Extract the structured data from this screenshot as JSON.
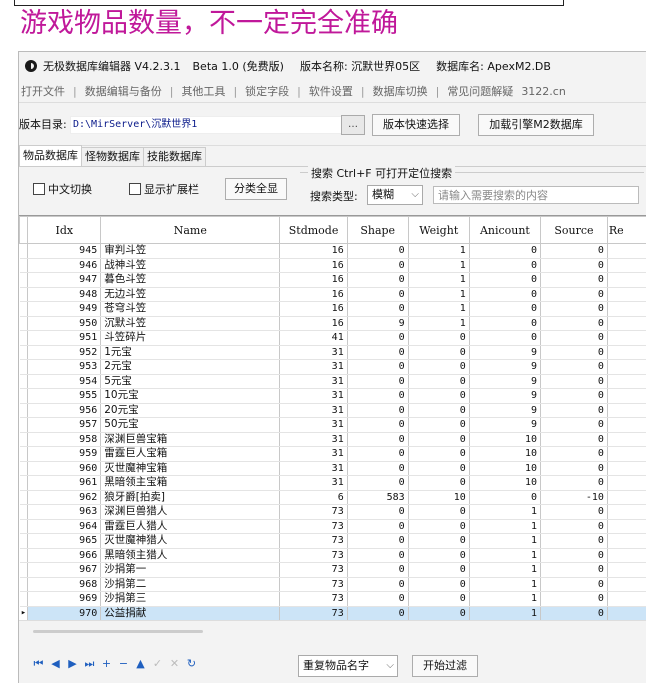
{
  "headline": "游戏物品数量，不一定完全准确",
  "window": {
    "app_title": "无极数据库编辑器 V4.2.3.1",
    "edition": "Beta 1.0 (免费版)",
    "version_name": "版本名称: 沉默世界05区",
    "db_name": "数据库名: ApexM2.DB"
  },
  "menu": [
    "打开文件",
    "数据编辑与备份",
    "其他工具",
    "锁定字段",
    "软件设置",
    "数据库切换",
    "常见问题解疑"
  ],
  "menu_extra": "3122.cn",
  "toolbar": {
    "dir_label": "版本目录:",
    "dir_path": "D:\\MirServer\\沉默世界1",
    "folder_icon_text": "…",
    "quick_select": "版本快速选择",
    "load_engine": "加载引擎M2数据库"
  },
  "tabs": [
    "物品数据库",
    "怪物数据库",
    "技能数据库"
  ],
  "filters": {
    "chinese_toggle": "中文切换",
    "show_ext": "显示扩展栏",
    "classify_btn": "分类全显",
    "search_legend": "搜索  Ctrl+F 可打开定位搜索",
    "search_type_label": "搜索类型:",
    "search_type_value": "模糊",
    "search_placeholder": "请输入需要搜索的内容"
  },
  "table": {
    "columns": [
      "Idx",
      "Name",
      "Stdmode",
      "Shape",
      "Weight",
      "Anicount",
      "Source",
      "Re"
    ],
    "rows": [
      {
        "idx": "945",
        "name": "审判斗笠",
        "stdmode": "16",
        "shape": "0",
        "weight": "1",
        "anicount": "0",
        "source": "0"
      },
      {
        "idx": "946",
        "name": "战神斗笠",
        "stdmode": "16",
        "shape": "0",
        "weight": "1",
        "anicount": "0",
        "source": "0"
      },
      {
        "idx": "947",
        "name": "暮色斗笠",
        "stdmode": "16",
        "shape": "0",
        "weight": "1",
        "anicount": "0",
        "source": "0"
      },
      {
        "idx": "948",
        "name": "无边斗笠",
        "stdmode": "16",
        "shape": "0",
        "weight": "1",
        "anicount": "0",
        "source": "0"
      },
      {
        "idx": "949",
        "name": "苍穹斗笠",
        "stdmode": "16",
        "shape": "0",
        "weight": "1",
        "anicount": "0",
        "source": "0"
      },
      {
        "idx": "950",
        "name": "沉默斗笠",
        "stdmode": "16",
        "shape": "9",
        "weight": "1",
        "anicount": "0",
        "source": "0"
      },
      {
        "idx": "951",
        "name": "斗笠碎片",
        "stdmode": "41",
        "shape": "0",
        "weight": "0",
        "anicount": "0",
        "source": "0"
      },
      {
        "idx": "952",
        "name": "1元宝",
        "stdmode": "31",
        "shape": "0",
        "weight": "0",
        "anicount": "9",
        "source": "0"
      },
      {
        "idx": "953",
        "name": "2元宝",
        "stdmode": "31",
        "shape": "0",
        "weight": "0",
        "anicount": "9",
        "source": "0"
      },
      {
        "idx": "954",
        "name": "5元宝",
        "stdmode": "31",
        "shape": "0",
        "weight": "0",
        "anicount": "9",
        "source": "0"
      },
      {
        "idx": "955",
        "name": "10元宝",
        "stdmode": "31",
        "shape": "0",
        "weight": "0",
        "anicount": "9",
        "source": "0"
      },
      {
        "idx": "956",
        "name": "20元宝",
        "stdmode": "31",
        "shape": "0",
        "weight": "0",
        "anicount": "9",
        "source": "0"
      },
      {
        "idx": "957",
        "name": "50元宝",
        "stdmode": "31",
        "shape": "0",
        "weight": "0",
        "anicount": "9",
        "source": "0"
      },
      {
        "idx": "958",
        "name": "深渊巨兽宝箱",
        "stdmode": "31",
        "shape": "0",
        "weight": "0",
        "anicount": "10",
        "source": "0"
      },
      {
        "idx": "959",
        "name": "雷霆巨人宝箱",
        "stdmode": "31",
        "shape": "0",
        "weight": "0",
        "anicount": "10",
        "source": "0"
      },
      {
        "idx": "960",
        "name": "灭世魔神宝箱",
        "stdmode": "31",
        "shape": "0",
        "weight": "0",
        "anicount": "10",
        "source": "0"
      },
      {
        "idx": "961",
        "name": "黑暗领主宝箱",
        "stdmode": "31",
        "shape": "0",
        "weight": "0",
        "anicount": "10",
        "source": "0"
      },
      {
        "idx": "962",
        "name": "狼牙爵[拍卖]",
        "stdmode": "6",
        "shape": "583",
        "weight": "10",
        "anicount": "0",
        "source": "-10"
      },
      {
        "idx": "963",
        "name": "深渊巨兽猎人",
        "stdmode": "73",
        "shape": "0",
        "weight": "0",
        "anicount": "1",
        "source": "0"
      },
      {
        "idx": "964",
        "name": "雷霆巨人猎人",
        "stdmode": "73",
        "shape": "0",
        "weight": "0",
        "anicount": "1",
        "source": "0"
      },
      {
        "idx": "965",
        "name": "灭世魔神猎人",
        "stdmode": "73",
        "shape": "0",
        "weight": "0",
        "anicount": "1",
        "source": "0"
      },
      {
        "idx": "966",
        "name": "黑暗领主猎人",
        "stdmode": "73",
        "shape": "0",
        "weight": "0",
        "anicount": "1",
        "source": "0"
      },
      {
        "idx": "967",
        "name": "沙捐第一",
        "stdmode": "73",
        "shape": "0",
        "weight": "0",
        "anicount": "1",
        "source": "0"
      },
      {
        "idx": "968",
        "name": "沙捐第二",
        "stdmode": "73",
        "shape": "0",
        "weight": "0",
        "anicount": "1",
        "source": "0"
      },
      {
        "idx": "969",
        "name": "沙捐第三",
        "stdmode": "73",
        "shape": "0",
        "weight": "0",
        "anicount": "1",
        "source": "0"
      },
      {
        "idx": "970",
        "name": "公益捐献",
        "stdmode": "73",
        "shape": "0",
        "weight": "0",
        "anicount": "1",
        "source": "0",
        "selected": true
      }
    ]
  },
  "bottom": {
    "nav_icons": [
      "first-icon",
      "prev-icon",
      "next-icon",
      "last-icon",
      "add-icon",
      "delete-icon",
      "up-icon",
      "check-icon",
      "cancel-icon",
      "refresh-icon"
    ],
    "nav_glyphs": [
      "⏮",
      "◀",
      "▶",
      "⏭",
      "+",
      "−",
      "▲",
      "✓",
      "✕",
      "↻"
    ],
    "dup_filter_value": "重复物品名字",
    "start_filter": "开始过滤"
  },
  "colors": {
    "headline": "#c0189a",
    "selection": "#cce4f7",
    "nav_icon": "#1f5fbf"
  }
}
